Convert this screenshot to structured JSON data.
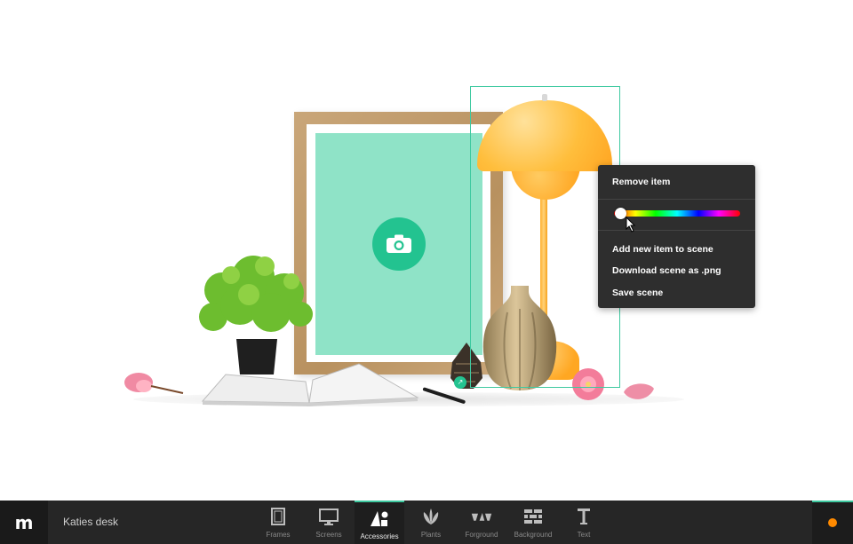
{
  "scene": {
    "name": "Katies desk"
  },
  "context_menu": {
    "remove_item": "Remove item",
    "color_slider": {
      "value": 0.05
    },
    "add_item": "Add new item to scene",
    "download": "Download scene as .png",
    "save": "Save scene"
  },
  "toolbar": {
    "logo": "m",
    "tabs": [
      {
        "label": "Frames",
        "icon": "frame-icon"
      },
      {
        "label": "Screens",
        "icon": "monitor-icon"
      },
      {
        "label": "Accessories",
        "icon": "shapes-icon",
        "active": true
      },
      {
        "label": "Plants",
        "icon": "plant-icon"
      },
      {
        "label": "Forground",
        "icon": "foreground-icon"
      },
      {
        "label": "Background",
        "icon": "brick-wall-icon"
      },
      {
        "label": "Text",
        "icon": "text-icon"
      }
    ]
  },
  "colors": {
    "accent": "#3ec9a0",
    "toolbar_bg": "#262626",
    "menu_bg": "#2e2e2e",
    "status_dot": "#ff8a00",
    "placeholder": "#8fe3c7"
  }
}
